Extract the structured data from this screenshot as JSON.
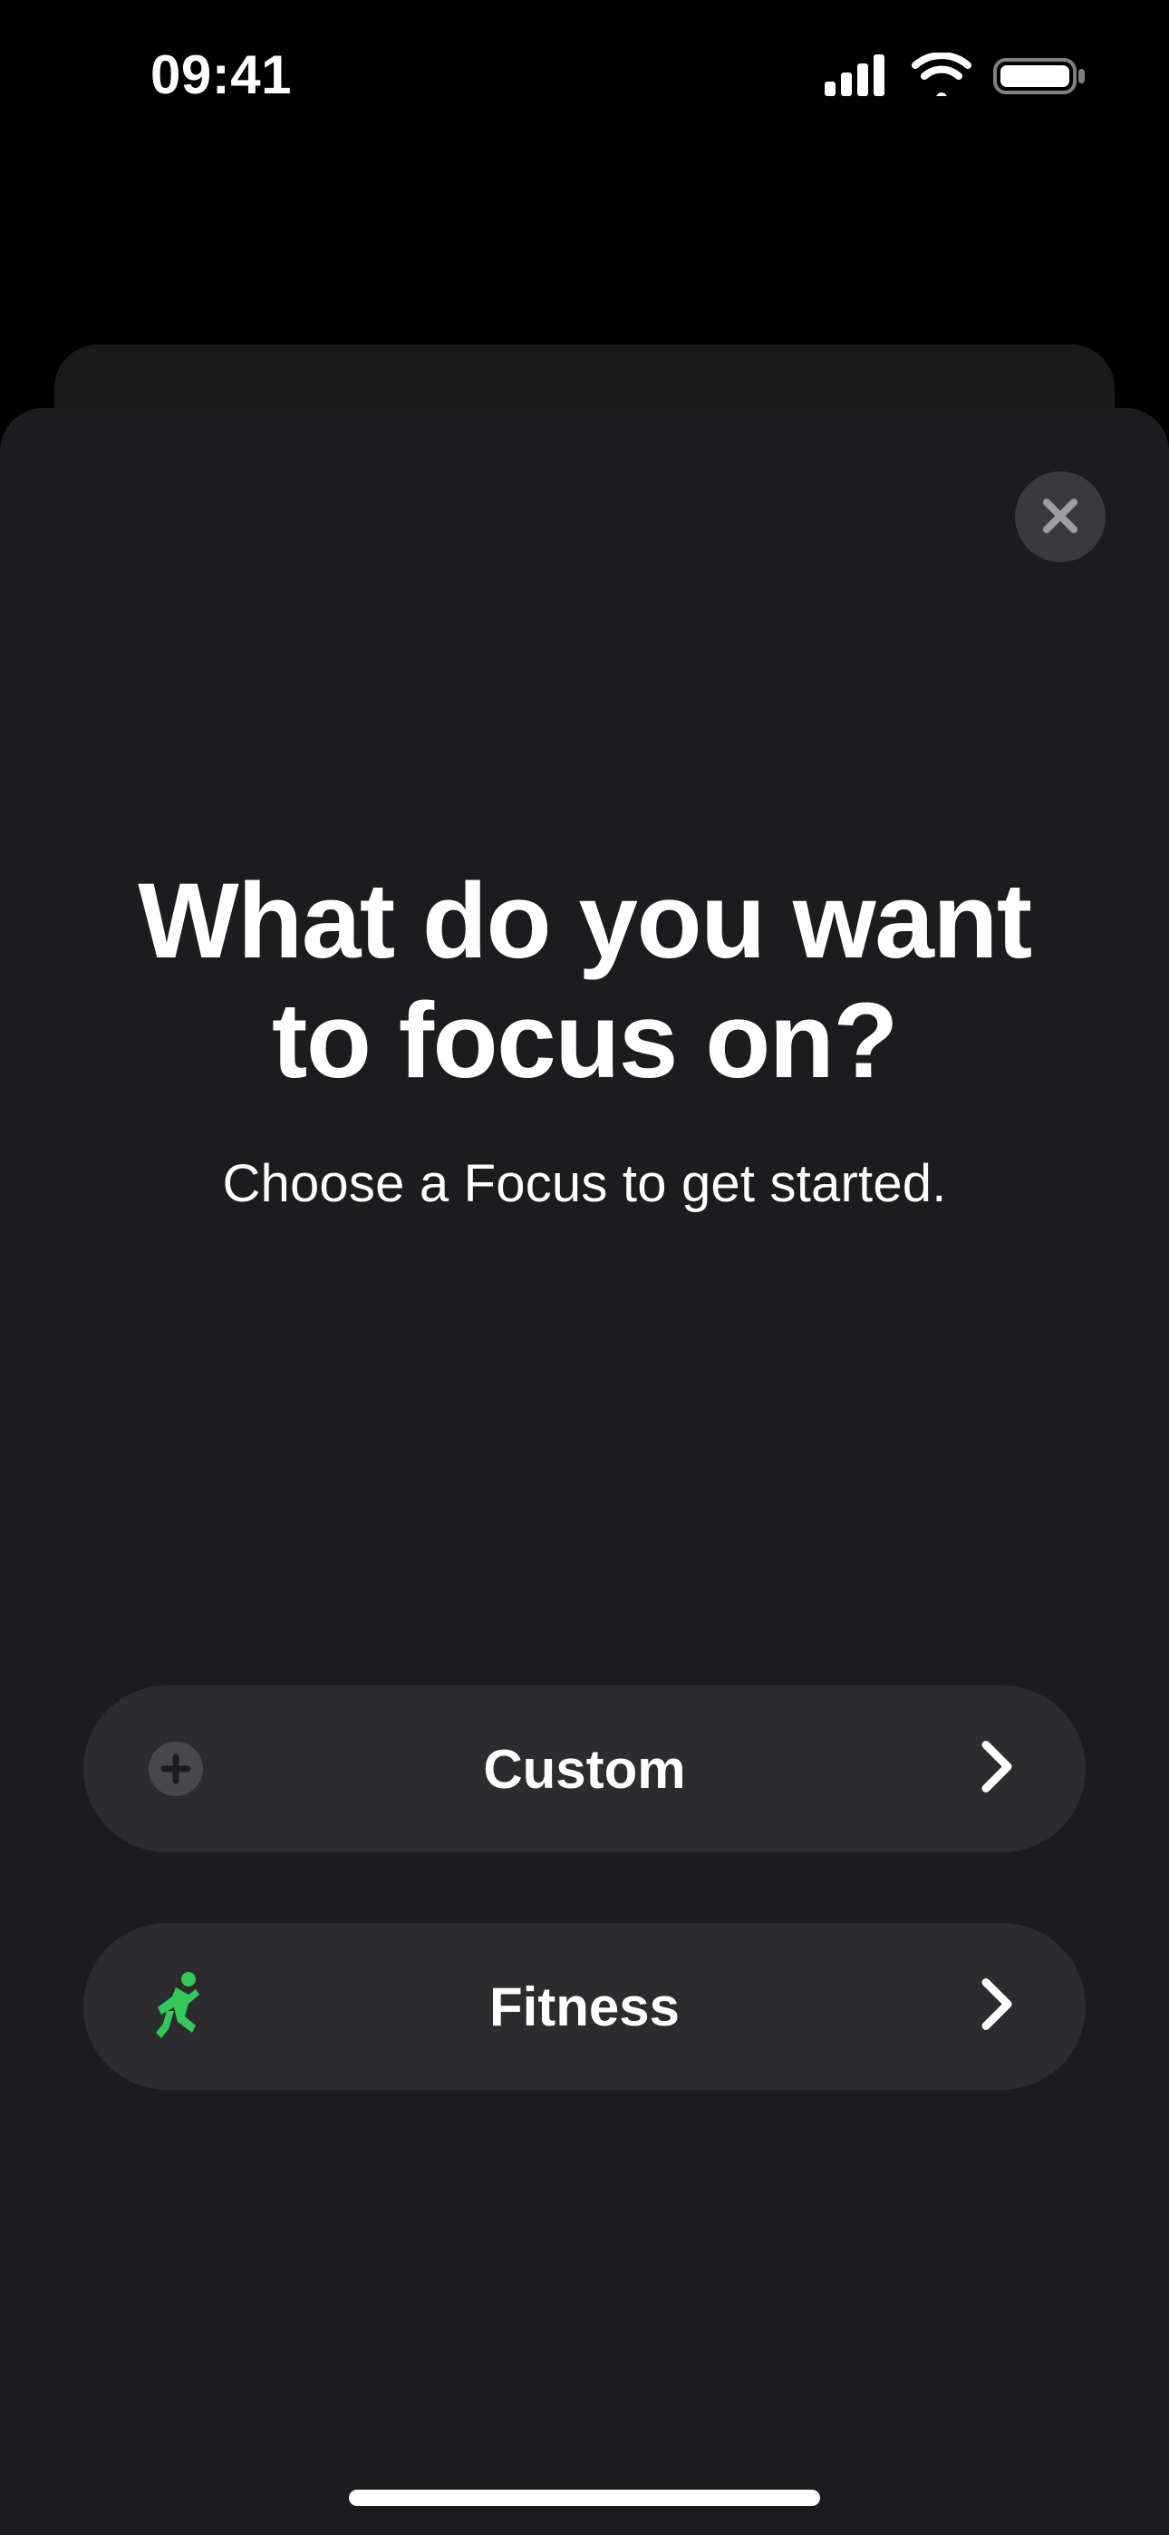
{
  "status": {
    "time": "09:41"
  },
  "sheet": {
    "title": "What do you want to focus on?",
    "subtitle": "Choose a Focus to get started."
  },
  "options": [
    {
      "label": "Custom",
      "icon": "plus-circle-icon",
      "icon_color": "#8e8e93"
    },
    {
      "label": "Fitness",
      "icon": "running-icon",
      "icon_color": "#34c759"
    }
  ]
}
